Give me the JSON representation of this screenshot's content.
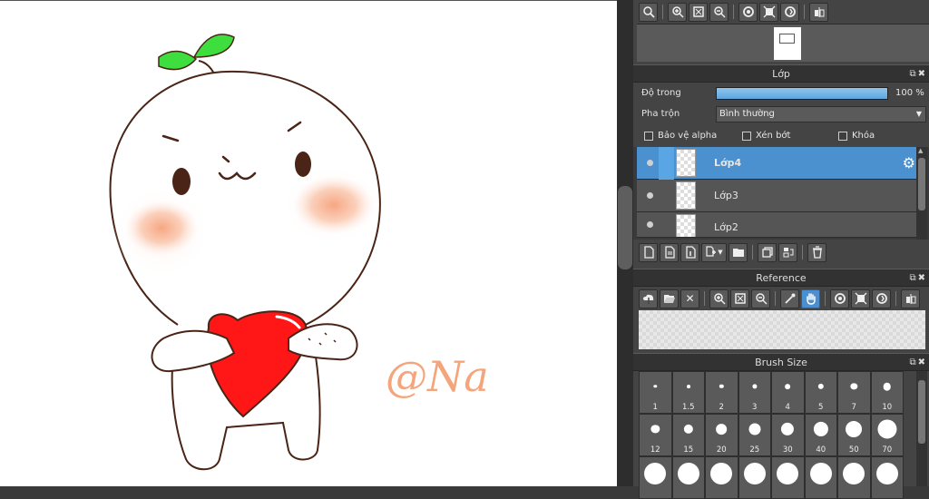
{
  "canvas": {
    "signature": "@Na",
    "colors": {
      "line": "#4a2416",
      "blush": "#f6a37e",
      "heart": "#ff1717",
      "leaf": "#3fde3f",
      "signature": "#f4a57c"
    }
  },
  "navigator": {
    "tools": [
      "zoom-fit-icon",
      "zoom-in-icon",
      "fit-screen-icon",
      "zoom-out-icon",
      "rotate-left-icon",
      "reset-view-icon",
      "rotate-right-icon",
      "flip-horizontal-icon"
    ]
  },
  "layer_panel": {
    "title": "Lớp",
    "opacity_label": "Độ trong",
    "opacity_value": "100 %",
    "opacity_fraction": 1.0,
    "blend_label": "Pha trộn",
    "blend_value": "Bình thường",
    "protect_alpha": "Bảo vệ alpha",
    "clipping": "Xén bớt",
    "lock": "Khóa",
    "layers": [
      {
        "name": "Lớp4",
        "selected": true
      },
      {
        "name": "Lớp3",
        "selected": false
      },
      {
        "name": "Lớp2",
        "selected": false
      }
    ]
  },
  "reference_panel": {
    "title": "Reference"
  },
  "brush_panel": {
    "title": "Brush Size",
    "sizes": [
      "1",
      "1.5",
      "2",
      "3",
      "4",
      "5",
      "7",
      "10",
      "12",
      "15",
      "20",
      "25",
      "30",
      "40",
      "50",
      "70",
      "",
      "",
      "",
      "",
      "",
      "",
      "",
      ""
    ]
  },
  "accent_color": "#4b90cf"
}
